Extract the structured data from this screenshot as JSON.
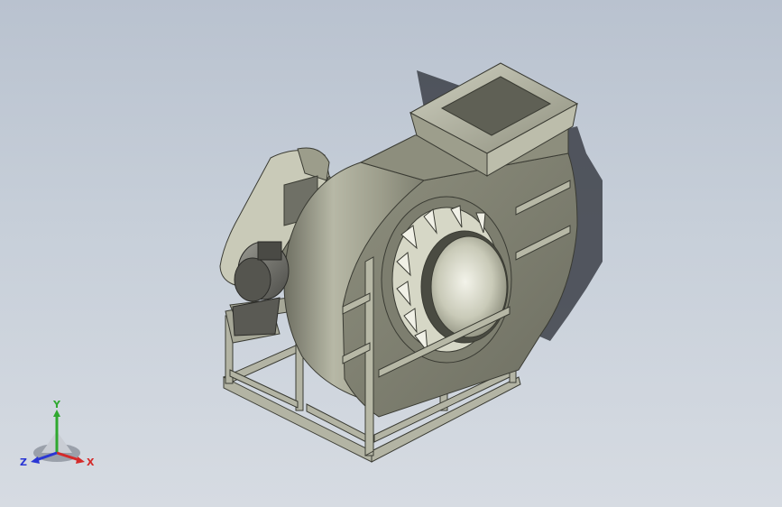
{
  "viewport": {
    "background_top": "#b9c2cf",
    "background_bottom": "#d6dbe2"
  },
  "model": {
    "icon": "centrifugal-fan-model",
    "body_color": "#a9aa98",
    "shadow_color": "#3c3f48"
  },
  "triad": {
    "x_label": "X",
    "y_label": "Y",
    "z_label": "Z",
    "x_color": "#d42a2a",
    "y_color": "#2fa82f",
    "z_color": "#2a36d4"
  }
}
